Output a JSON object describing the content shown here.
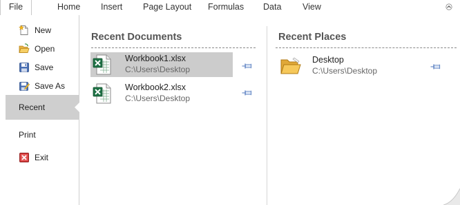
{
  "ribbon": {
    "tabs": [
      {
        "label": "File"
      },
      {
        "label": "Home"
      },
      {
        "label": "Insert"
      },
      {
        "label": "Page Layout"
      },
      {
        "label": "Formulas"
      },
      {
        "label": "Data"
      },
      {
        "label": "View"
      }
    ],
    "collapse_icon": "chevron-up-icon"
  },
  "sidebar": {
    "items": [
      {
        "label": "New",
        "icon": "new-document-icon"
      },
      {
        "label": "Open",
        "icon": "open-folder-icon"
      },
      {
        "label": "Save",
        "icon": "floppy-disk-icon"
      },
      {
        "label": "Save As",
        "icon": "save-as-icon"
      },
      {
        "label": "Recent",
        "selected": true
      },
      {
        "label": "Print"
      },
      {
        "label": "Exit",
        "icon": "exit-icon"
      }
    ]
  },
  "recent_documents": {
    "title": "Recent Documents",
    "items": [
      {
        "name": "Workbook1.xlsx",
        "path": "C:\\Users\\Desktop",
        "selected": true
      },
      {
        "name": "Workbook2.xlsx",
        "path": "C:\\Users\\Desktop",
        "selected": false
      }
    ]
  },
  "recent_places": {
    "title": "Recent Places",
    "items": [
      {
        "name": "Desktop",
        "path": "C:\\Users\\Desktop"
      }
    ]
  },
  "colors": {
    "selected_bg": "#cccccc",
    "excel_green": "#1e7145",
    "folder_yellow": "#f2c35a",
    "pin_blue": "#6a8cc7",
    "exit_red": "#c8282e"
  }
}
